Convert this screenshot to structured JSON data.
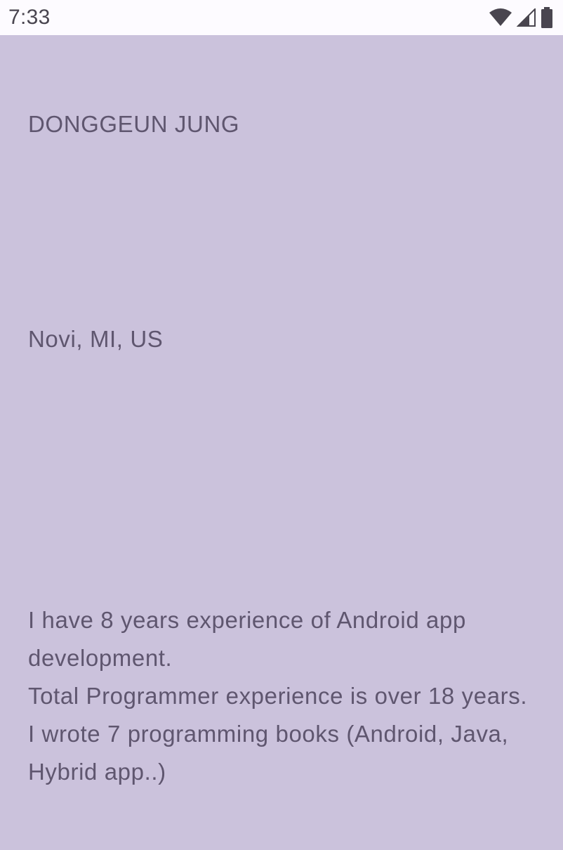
{
  "status_bar": {
    "time": "7:33",
    "icons": [
      "wifi-icon",
      "cell-signal-icon",
      "battery-icon"
    ]
  },
  "profile": {
    "name": "DONGGEUN JUNG",
    "location": "Novi, MI, US",
    "bio": "I have 8 years experience of Android app development.\nTotal Programmer experience is over 18 years.\nI wrote 7 programming books (Android, Java, Hybrid app..)"
  },
  "colors": {
    "background": "#cbc2dc",
    "status_bar": "#fdfbff",
    "text": "#5f566f"
  }
}
